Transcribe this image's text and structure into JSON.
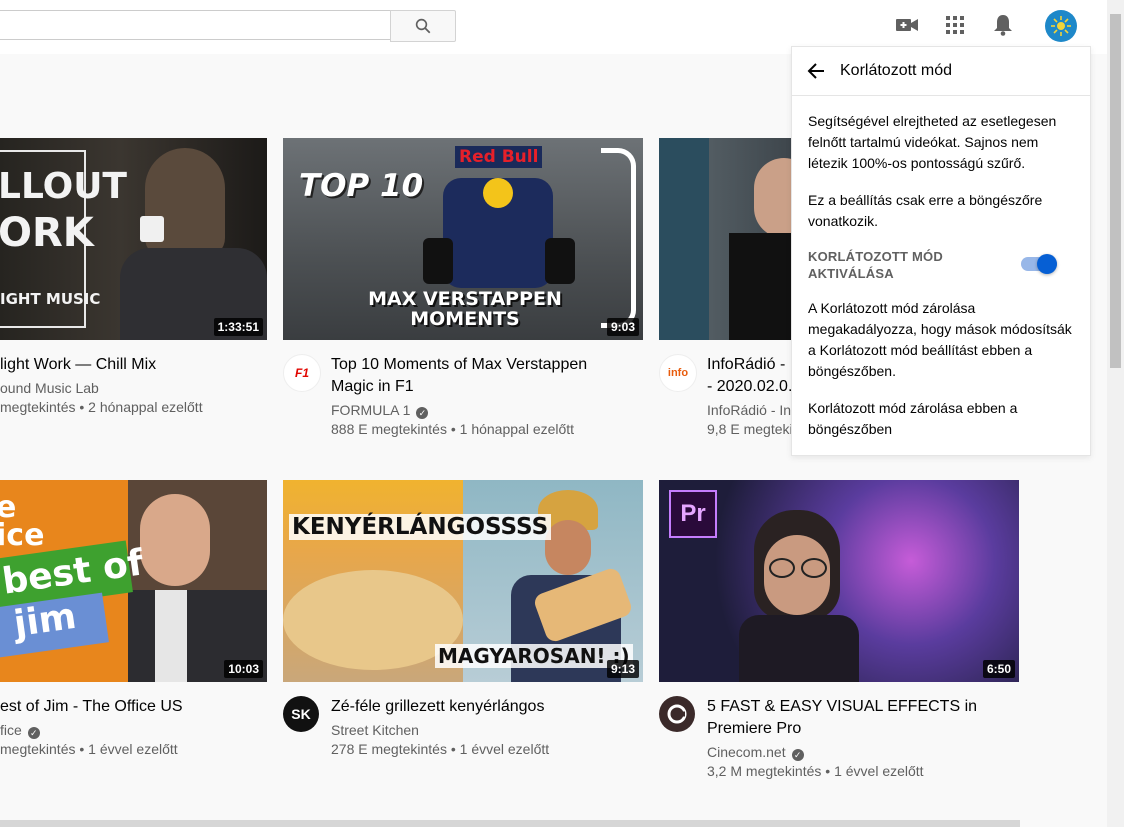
{
  "search": {
    "placeholder": ""
  },
  "icons": {
    "search": "search-icon",
    "create": "video-camera-icon",
    "apps": "apps-grid-icon",
    "notifications": "bell-icon",
    "avatar": "user-avatar-icon"
  },
  "panel": {
    "title": "Korlátozott mód",
    "desc1": "Segítségével elrejtheted az esetlegesen felnőtt tartalmú videókat. Sajnos nem létezik 100%-os pontosságú szűrő.",
    "desc2": "Ez a beállítás csak erre a böngészőre vonatkozik.",
    "toggle_label": "KORLÁTOZOTT MÓD AKTIVÁLÁSA",
    "toggle_on": true,
    "desc3": "A Korlátozott mód zárolása megakadályozza, hogy mások módosítsák a Korlátozott mód beállítást ebben a böngészőben.",
    "lock_link": "Korlátozott mód zárolása ebben a böngészőben"
  },
  "thumb_text": {
    "v1": [
      "LLOUT",
      "ORK",
      "IGHT MUSIC"
    ],
    "v2_top": "TOP 10",
    "v2_bottom": [
      "MAX VERSTAPPEN",
      "MOMENTS"
    ],
    "v2_brand": "Red Bull",
    "v4": [
      "e",
      "ice",
      "best of",
      "jim"
    ],
    "v5_top": "KENYÉRLÁNGOSSSS",
    "v5_bottom": "MAGYAROSAN! :)",
    "v6": "Pr",
    "v3_logo": "info"
  },
  "videos": [
    {
      "duration": "1:33:51",
      "title": "light Work — Chill Mix",
      "channel": "ound Music Lab",
      "meta": "megtekintés • 2 hónappal ezelőtt"
    },
    {
      "duration": "9:03",
      "title_line1": "Top 10 Moments of Max Verstappen",
      "title_line2": "Magic in F1",
      "channel": "FORMULA 1",
      "meta": "888 E megtekintés • 1 hónappal ezelőtt",
      "avatar_text": "F1"
    },
    {
      "title_line1": "InfoRádió - ...",
      "title_line2": "- 2020.02.0...",
      "channel": "InfoRádió - Int",
      "meta": "9,8 E megtekin"
    },
    {
      "duration": "10:03",
      "title": "est of Jim - The Office US",
      "channel": "fice",
      "meta": "megtekintés • 1 évvel ezelőtt"
    },
    {
      "duration": "9:13",
      "title": "Zé-féle grillezett kenyérlángos",
      "channel": "Street Kitchen",
      "meta": "278 E megtekintés • 1 évvel ezelőtt",
      "avatar_text": "SK"
    },
    {
      "duration": "6:50",
      "title_line1": "5 FAST & EASY VISUAL EFFECTS in",
      "title_line2": "Premiere Pro",
      "channel": "Cinecom.net",
      "meta": "3,2 M megtekintés • 1 évvel ezelőtt"
    }
  ],
  "colors": {
    "accent": "#065fd4",
    "background": "#f9f9f9",
    "meta_text": "#606060"
  }
}
